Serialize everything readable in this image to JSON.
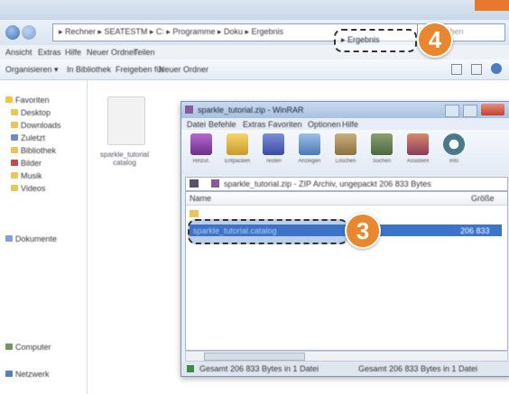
{
  "explorer": {
    "breadcrumb": "▸ Rechner ▸ SEATESTM ▸ C: ▸ Programme ▸ Doku ▸ Ergebnis",
    "breadcrumb_highlight": "▸ Ergebnis",
    "search_placeholder": "Suchen",
    "menu": [
      "Ansicht",
      "Extras",
      "Hilfe",
      "Neuer Ordner",
      "Teilen"
    ],
    "toolbar": [
      "Organisieren ▾",
      "In Bibliothek",
      "Freigeben für",
      "Neuer Ordner"
    ],
    "nav_items": [
      "Favoriten",
      "Desktop",
      "Downloads",
      "Zuletzt",
      "Bibliothek",
      "Bilder",
      "Musik",
      "Videos",
      "Dokumente",
      "Computer",
      "Netzwerk"
    ],
    "file_label": "sparkle_tutorial catalog"
  },
  "archive": {
    "title": "sparkle_tutorial.zip - WinRAR",
    "menu": [
      "Datei",
      "Befehle",
      "Extras",
      "Favoriten",
      "Optionen",
      "Hilfe"
    ],
    "tools": [
      {
        "label": "Hinzuf.",
        "icon": "add-icon"
      },
      {
        "label": "Entpacken",
        "icon": "extract-icon"
      },
      {
        "label": "Testen",
        "icon": "test-icon"
      },
      {
        "label": "Anzeigen",
        "icon": "view-icon"
      },
      {
        "label": "Löschen",
        "icon": "delete-icon"
      },
      {
        "label": "Suchen",
        "icon": "find-icon"
      },
      {
        "label": "Assistent",
        "icon": "wizard-icon"
      },
      {
        "label": "Info",
        "icon": "info-icon"
      }
    ],
    "path": "sparkle_tutorial.zip - ZIP Archiv, ungepackt 206 833 Bytes",
    "columns": [
      "Name",
      "Größe"
    ],
    "row": {
      "name": "sparkle_tutorial.catalog",
      "size": "206 833"
    },
    "status_left": "Gesamt 206 833 Bytes in 1 Datei",
    "status_right": "Gesamt 206 833 Bytes in 1 Datei"
  },
  "callouts": {
    "step3": "3",
    "step4": "4"
  },
  "colors": {
    "accent": "#e8872e",
    "selection": "#3c74c9"
  }
}
